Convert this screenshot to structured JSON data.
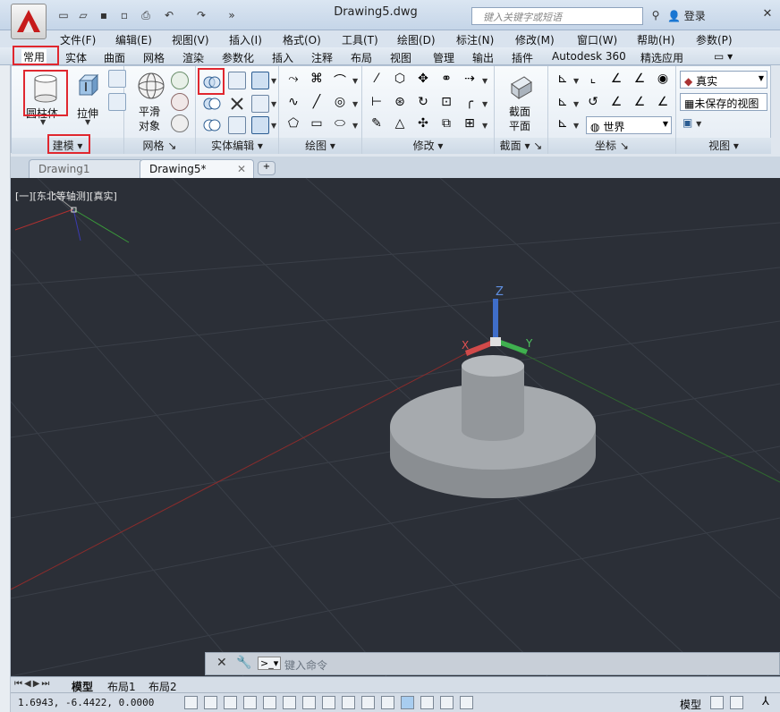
{
  "window": {
    "title": "Drawing5.dwg"
  },
  "search": {
    "placeholder": "键入关键字或短语"
  },
  "account": {
    "login_label": "登录"
  },
  "menu": [
    "文件(F)",
    "编辑(E)",
    "视图(V)",
    "插入(I)",
    "格式(O)",
    "工具(T)",
    "绘图(D)",
    "标注(N)",
    "修改(M)",
    "窗口(W)",
    "帮助(H)",
    "参数(P)"
  ],
  "ribbon_tabs": [
    "常用",
    "实体",
    "曲面",
    "网格",
    "渲染",
    "参数化",
    "插入",
    "注释",
    "布局",
    "视图",
    "管理",
    "输出",
    "插件",
    "Autodesk 360",
    "精选应用"
  ],
  "ribbon": {
    "modeling": {
      "cylinder_label": "圆柱体",
      "extrude_label": "拉伸",
      "title": "建模"
    },
    "mesh": {
      "smooth_line1": "平滑",
      "smooth_line2": "对象",
      "title": "网格"
    },
    "solid_editing": {
      "title": "实体编辑"
    },
    "draw": {
      "title": "绘图"
    },
    "modify": {
      "title": "修改"
    },
    "section": {
      "plane_line1": "截面",
      "plane_line2": "平面",
      "title": "截面"
    },
    "coordinates": {
      "world_label": "世界",
      "title": "坐标"
    },
    "view": {
      "visual_style": "真实",
      "saved_view": "未保存的视图",
      "title": "视图"
    }
  },
  "doc_tabs": [
    "Drawing1",
    "Drawing5*"
  ],
  "viewport": {
    "label": "[一][东北等轴测][真实]"
  },
  "axes": {
    "x": "X",
    "y": "Y",
    "z": "Z"
  },
  "command_line": {
    "placeholder": "键入命令"
  },
  "layout_tabs": [
    "模型",
    "布局1",
    "布局2"
  ],
  "status": {
    "coordinates": "1.6943,  -6.4422, 0.0000",
    "model_label": "模型"
  },
  "colors": {
    "highlight": "#e0272f",
    "viewport_bg": "#2b2f37",
    "accent": "#c61b1b"
  }
}
